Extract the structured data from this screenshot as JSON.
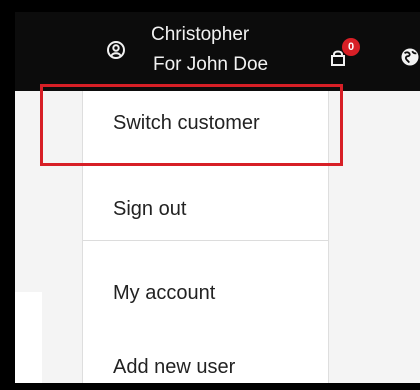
{
  "header": {
    "user_name": "Christopher",
    "user_subtitle": "For John Doe",
    "cart_count": "0",
    "user_icon": "user-circle-icon",
    "cart_icon": "shopping-bag-icon",
    "globe_icon": "globe-icon"
  },
  "menu": {
    "items": [
      {
        "label": "Switch customer"
      },
      {
        "label": "Sign out"
      },
      {
        "label": "My account"
      },
      {
        "label": "Add new user"
      }
    ]
  },
  "colors": {
    "header_bg": "#0c0c0c",
    "badge": "#d81f26",
    "highlight": "#d71f26",
    "page_bg": "#f4f4f4"
  }
}
